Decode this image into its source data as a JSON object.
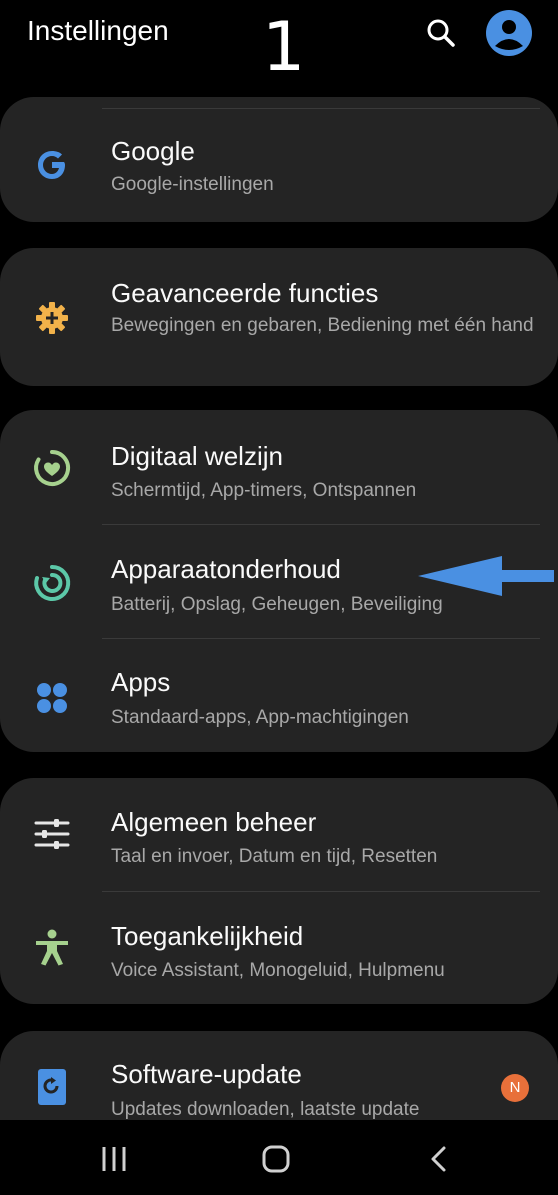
{
  "header": {
    "title": "Instellingen",
    "step_number": "1"
  },
  "sections": [
    {
      "items": [
        {
          "title": "Google",
          "subtitle": "Google-instellingen",
          "icon": "google-icon"
        }
      ]
    },
    {
      "items": [
        {
          "title": "Geavanceerde functies",
          "subtitle": "Bewegingen en gebaren, Bediening met één hand",
          "icon": "gear-plus-icon"
        }
      ]
    },
    {
      "items": [
        {
          "title": "Digitaal welzijn",
          "subtitle": "Schermtijd, App-timers, Ontspannen",
          "icon": "digital-wellbeing-icon"
        },
        {
          "title": "Apparaatonderhoud",
          "subtitle": "Batterij, Opslag, Geheugen, Beveiliging",
          "icon": "device-care-icon"
        },
        {
          "title": "Apps",
          "subtitle": "Standaard-apps, App-machtigingen",
          "icon": "apps-grid-icon"
        }
      ]
    },
    {
      "items": [
        {
          "title": "Algemeen beheer",
          "subtitle": "Taal en invoer, Datum en tijd, Resetten",
          "icon": "sliders-icon"
        },
        {
          "title": "Toegankelijkheid",
          "subtitle": "Voice Assistant, Monogeluid, Hulpmenu",
          "icon": "accessibility-icon"
        }
      ]
    },
    {
      "items": [
        {
          "title": "Software-update",
          "subtitle": "Updates downloaden, laatste update",
          "icon": "software-update-icon"
        }
      ]
    }
  ],
  "badge": {
    "label": "N",
    "color": "#e8703a"
  },
  "colors": {
    "accent_blue": "#4a90e2",
    "icon_green": "#a6d18e",
    "icon_teal": "#5cc8a8",
    "icon_orange": "#f2b24a"
  },
  "navbar": [
    "recent-apps-icon",
    "home-icon",
    "back-icon"
  ]
}
